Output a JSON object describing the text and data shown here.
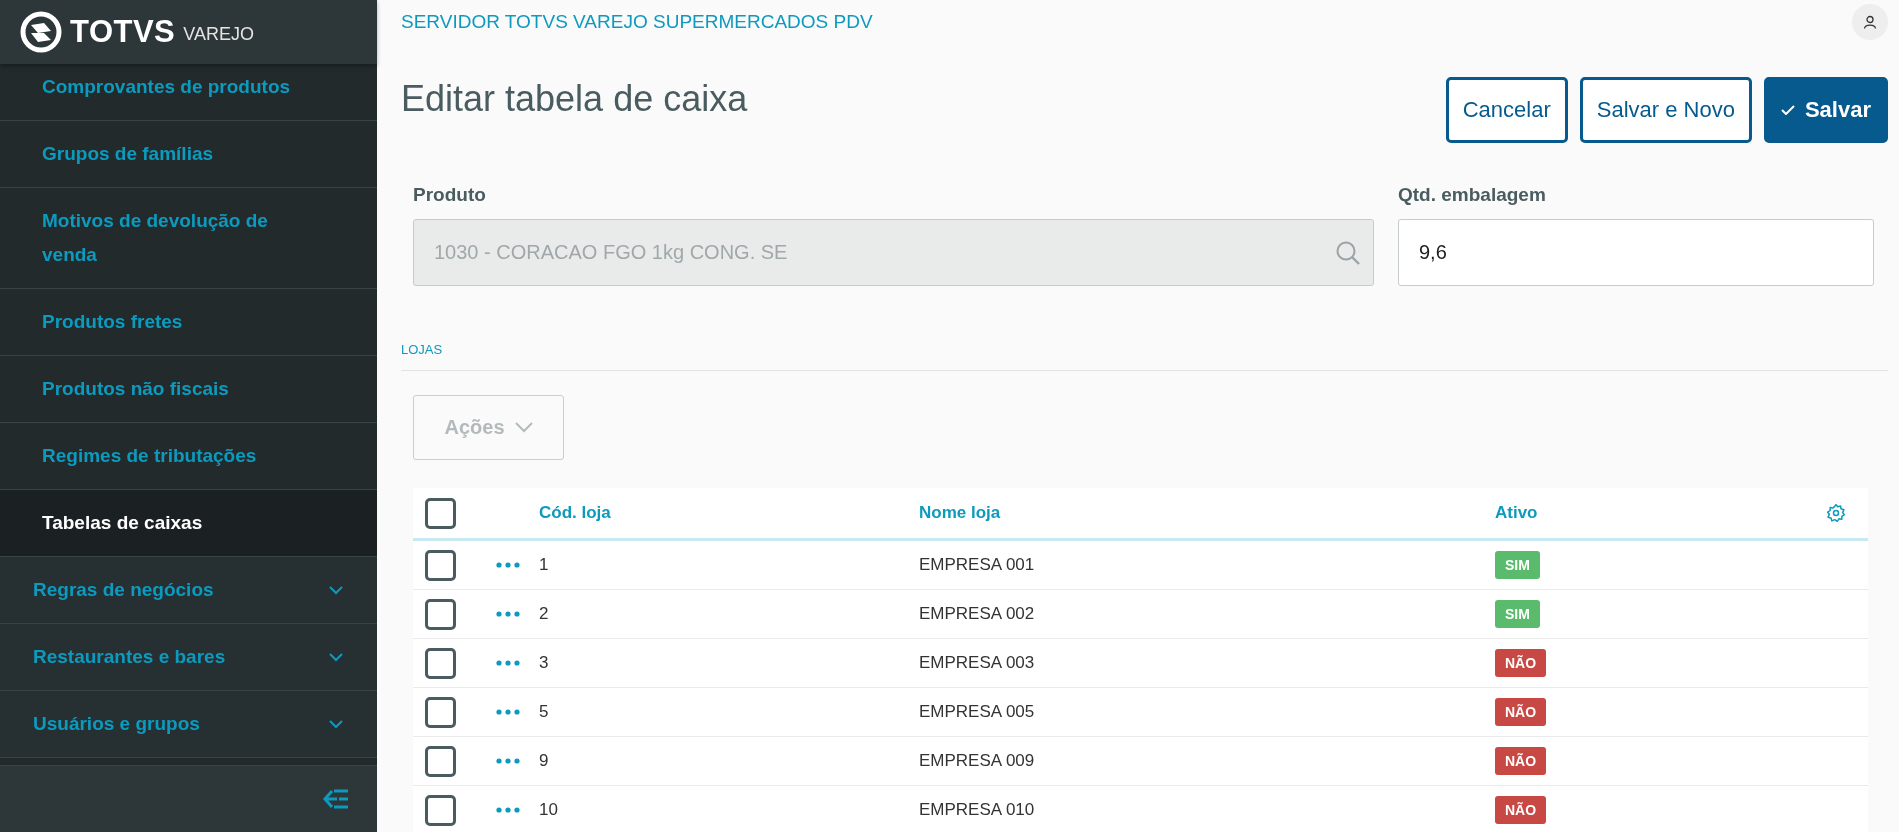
{
  "app": {
    "logo": "TOTVS",
    "logo_sub": "VAREJO"
  },
  "sidebar": {
    "items": [
      {
        "label": "Comprovantes de produtos",
        "kind": "link",
        "selected": false
      },
      {
        "label": "Grupos de famílias",
        "kind": "link",
        "selected": false
      },
      {
        "label": "Motivos de devolução de venda",
        "kind": "link",
        "selected": false
      },
      {
        "label": "Produtos fretes",
        "kind": "link",
        "selected": false
      },
      {
        "label": "Produtos não fiscais",
        "kind": "link",
        "selected": false
      },
      {
        "label": "Regimes de tributações",
        "kind": "link",
        "selected": false
      },
      {
        "label": "Tabelas de caixas",
        "kind": "link",
        "selected": true
      },
      {
        "label": "Regras de negócios",
        "kind": "group",
        "expanded": false
      },
      {
        "label": "Restaurantes e bares",
        "kind": "group",
        "expanded": false
      },
      {
        "label": "Usuários e grupos",
        "kind": "group",
        "expanded": false
      }
    ]
  },
  "header": {
    "server": "SERVIDOR TOTVS VAREJO SUPERMERCADOS PDV"
  },
  "page": {
    "title": "Editar tabela de caixa",
    "buttons": [
      {
        "label": "Cancelar",
        "kind": "secondary"
      },
      {
        "label": "Salvar e Novo",
        "kind": "secondary"
      },
      {
        "label": "Salvar",
        "kind": "primary"
      }
    ]
  },
  "fields": [
    {
      "label": "Produto",
      "value": "1030 - CORACAO FGO 1kg CONG. SE",
      "kind": "search",
      "disabled": true
    },
    {
      "label": "Qtd. embalagem",
      "value": "9,6",
      "kind": "text",
      "disabled": false
    }
  ],
  "section": {
    "title": "LOJAS",
    "actions": {
      "label": "Ações",
      "disabled": true
    }
  },
  "table": {
    "columns": [
      "Cód. loja",
      "Nome loja",
      "Ativo"
    ],
    "all_checked": false,
    "rows": [
      {
        "code": "1",
        "name": "EMPRESA 001",
        "status": "SIM",
        "active": true,
        "checked": false
      },
      {
        "code": "2",
        "name": "EMPRESA 002",
        "status": "SIM",
        "active": true,
        "checked": false
      },
      {
        "code": "3",
        "name": "EMPRESA 003",
        "status": "NÃO",
        "active": false,
        "checked": false
      },
      {
        "code": "5",
        "name": "EMPRESA 005",
        "status": "NÃO",
        "active": false,
        "checked": false
      },
      {
        "code": "9",
        "name": "EMPRESA 009",
        "status": "NÃO",
        "active": false,
        "checked": false
      },
      {
        "code": "10",
        "name": "EMPRESA 010",
        "status": "NÃO",
        "active": false,
        "checked": false
      }
    ]
  }
}
